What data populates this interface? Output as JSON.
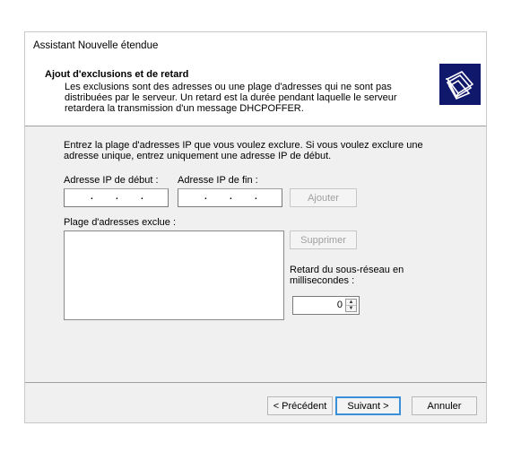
{
  "window": {
    "title": "Assistant Nouvelle étendue"
  },
  "header": {
    "title": "Ajout d'exclusions et de retard",
    "description": "Les exclusions sont des adresses ou une plage d'adresses qui ne sont pas distribuées par le serveur. Un retard est la durée pendant laquelle le serveur retardera la transmission d'un message DHCPOFFER.",
    "icon": "folders-icon"
  },
  "main": {
    "intro": "Entrez la plage d'adresses IP que vous voulez exclure. Si vous voulez exclure une adresse unique, entrez uniquement une adresse IP de début.",
    "start_ip_label": "Adresse IP de début :",
    "end_ip_label": "Adresse IP de fin :",
    "add_button": "Ajouter",
    "excluded_label": "Plage d'adresses exclue :",
    "remove_button": "Supprimer",
    "delay_label": "Retard du sous-réseau en millisecondes :",
    "delay_value": "0"
  },
  "footer": {
    "back_button": "< Précédent",
    "next_button": "Suivant >",
    "cancel_button": "Annuler"
  }
}
